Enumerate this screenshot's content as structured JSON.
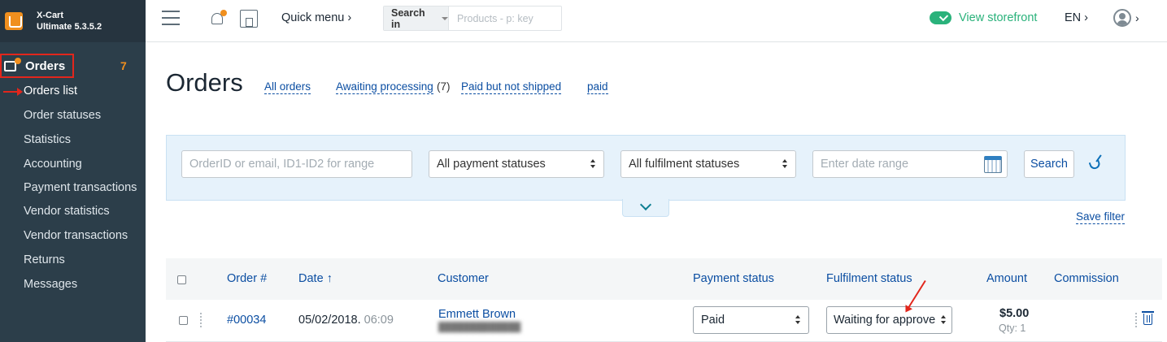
{
  "brand": {
    "line1": "X-Cart",
    "line2": "Ultimate 5.3.5.2"
  },
  "sidebar": {
    "orders_label": "Orders",
    "orders_count": "7",
    "items": [
      {
        "label": "Orders list"
      },
      {
        "label": "Order statuses"
      },
      {
        "label": "Statistics"
      },
      {
        "label": "Accounting"
      },
      {
        "label": "Payment transactions"
      },
      {
        "label": "Vendor statistics"
      },
      {
        "label": "Vendor transactions"
      },
      {
        "label": "Returns"
      },
      {
        "label": "Messages"
      }
    ]
  },
  "topbar": {
    "quick_menu": "Quick menu ›",
    "search_in": "Search in",
    "search_placeholder": "Products - p: key",
    "view_storefront": "View storefront",
    "language": "EN ›",
    "user_chevron": "›",
    "storefront_toggle_color": "#2ab27b"
  },
  "page": {
    "title": "Orders",
    "tabs": [
      "All orders",
      "Awaiting processing",
      "Paid but not shipped",
      "paid"
    ],
    "awaiting_count": "(7)"
  },
  "filter": {
    "order_placeholder": "OrderID or email, ID1-ID2 for range",
    "payment_status": "All payment statuses",
    "fulfilment_status": "All fulfilment statuses",
    "date_placeholder": "Enter date range",
    "search_button": "Search",
    "save_filter": "Save filter"
  },
  "table": {
    "columns": [
      "Order #",
      "Date ↑",
      "Customer",
      "Payment status",
      "Fulfilment status",
      "Amount",
      "Commission"
    ],
    "rows": [
      {
        "order": "#00034",
        "date": "05/02/2018.",
        "time": "06:09",
        "customer": "Emmett Brown",
        "payment_status": "Paid",
        "fulfilment_status": "Waiting for approve",
        "amount": "$5.00",
        "qty": "Qty: 1"
      }
    ]
  },
  "colors": {
    "accent": "#0b4ea2",
    "sidebar": "#2c3e4a",
    "brand": "#f08f1e",
    "highlight": "#e2261c"
  }
}
